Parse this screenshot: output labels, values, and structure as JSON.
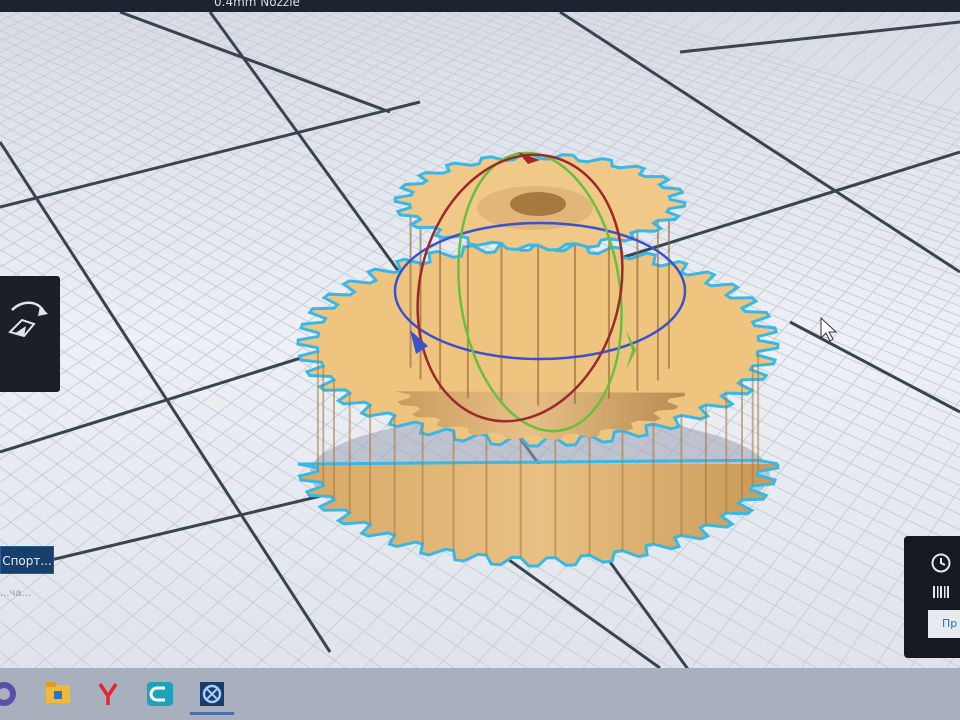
{
  "window": {
    "title_fragment": "0.4mm Nozzle"
  },
  "left_panel": {
    "rotate_tool_icon": "rotate-icon",
    "export_button_label": "Спорт...",
    "status_text": "...ча..."
  },
  "right_panel": {
    "time_icon": "clock-icon",
    "material_icon": "filament-spool-icon",
    "preview_button_label": "Пр"
  },
  "taskbar": {
    "items": [
      {
        "name": "start-orb-icon"
      },
      {
        "name": "file-explorer-icon"
      },
      {
        "name": "yandex-browser-icon"
      },
      {
        "name": "cura-slicer-icon"
      },
      {
        "name": "repetier-app-icon"
      }
    ]
  },
  "colors": {
    "model": "#e9bd72",
    "model_outline": "#39b8e6",
    "rotate_x_ring": "#9b2a2a",
    "rotate_y_ring": "#68bf3e",
    "rotate_z_ring": "#3a52cc",
    "build_plate": "#e6eaf1",
    "grid_major": "#3a4350"
  }
}
